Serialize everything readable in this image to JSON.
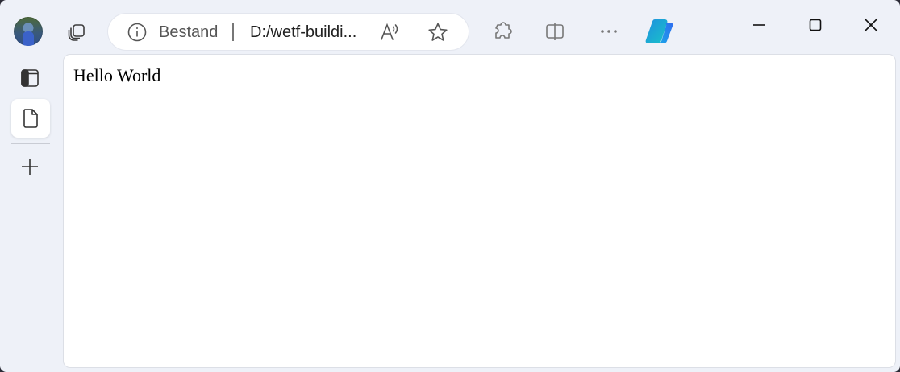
{
  "browser": {
    "address_bar": {
      "site_info_label": "Bestand",
      "url": "D:/wetf-buildi..."
    },
    "icons": {
      "profile": "avatar",
      "tab_actions": "tab-actions-icon",
      "site_info": "info-icon",
      "read_aloud": "read-aloud-icon",
      "favorites": "star-icon",
      "extensions": "puzzle-icon",
      "split_screen": "split-screen-icon",
      "more": "more-icon",
      "copilot": "copilot-icon",
      "minimize": "minimize-icon",
      "maximize": "maximize-icon",
      "close": "close-icon"
    },
    "accent_colors": {
      "copilot_start": "#1f8fe0",
      "copilot_end": "#19c3c8"
    }
  },
  "sidebar": {
    "icons": [
      "tabs-panel-icon",
      "page-icon",
      "plus-icon"
    ]
  },
  "page": {
    "body_text": "Hello World"
  }
}
